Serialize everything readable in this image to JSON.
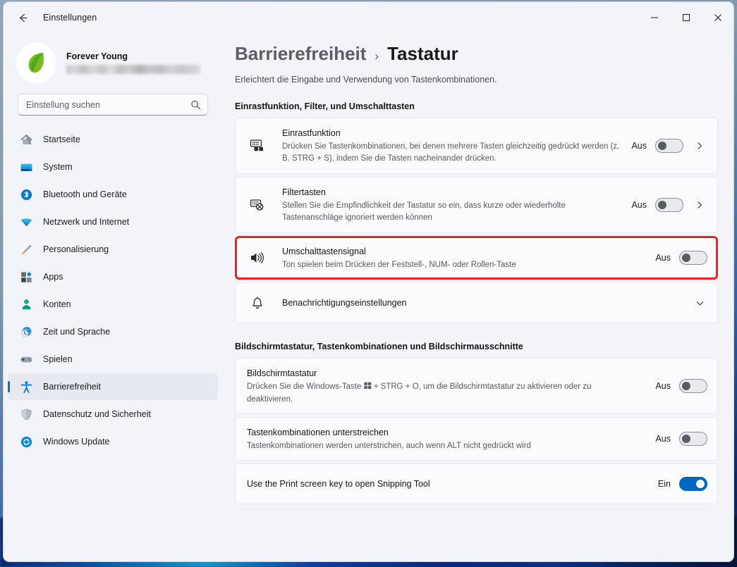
{
  "window": {
    "app_title": "Einstellungen",
    "back_icon": "back-arrow-icon",
    "minimize_label": "—",
    "maximize_label": "□",
    "close_label": "✕"
  },
  "sidebar": {
    "account": {
      "name": "Forever Young",
      "email_redacted": true,
      "avatar_icon": "leaf-avatar-icon"
    },
    "search": {
      "placeholder": "Einstellung suchen",
      "value": "",
      "icon": "search-icon"
    },
    "items": [
      {
        "label": "Startseite",
        "icon": "home-icon",
        "selected": false
      },
      {
        "label": "System",
        "icon": "system-monitor-icon",
        "selected": false
      },
      {
        "label": "Bluetooth und Geräte",
        "icon": "bluetooth-icon",
        "selected": false
      },
      {
        "label": "Netzwerk und Internet",
        "icon": "wifi-icon",
        "selected": false
      },
      {
        "label": "Personalisierung",
        "icon": "paintbrush-icon",
        "selected": false
      },
      {
        "label": "Apps",
        "icon": "apps-icon",
        "selected": false
      },
      {
        "label": "Konten",
        "icon": "account-person-icon",
        "selected": false
      },
      {
        "label": "Zeit und Sprache",
        "icon": "clock-globe-icon",
        "selected": false
      },
      {
        "label": "Spielen",
        "icon": "gamepad-icon",
        "selected": false
      },
      {
        "label": "Barrierefreiheit",
        "icon": "accessibility-person-icon",
        "selected": true
      },
      {
        "label": "Datenschutz und Sicherheit",
        "icon": "shield-icon",
        "selected": false
      },
      {
        "label": "Windows Update",
        "icon": "update-refresh-icon",
        "selected": false
      }
    ]
  },
  "main": {
    "breadcrumb": {
      "parent": "Barrierefreiheit",
      "separator": "›",
      "current": "Tastatur"
    },
    "subtitle": "Erleichtert die Eingabe und Verwendung von Tastenkombinationen.",
    "sections": [
      {
        "title": "Einrastfunktion, Filter, und Umschalttasten",
        "rows": [
          {
            "icon": "sticky-keys-icon",
            "title": "Einrastfunktion",
            "desc": "Drücken Sie Tastenkombinationen, bei denen mehrere Tasten gleichzeitig gedrückt werden (z. B. STRG + S), indem Sie die Tasten nacheinander drücken.",
            "state_label": "Aus",
            "toggle": "off",
            "chevron": "chevron-right-icon",
            "highlighted": false
          },
          {
            "icon": "filter-keys-icon",
            "title": "Filtertasten",
            "desc": "Stellen Sie die Empfindlichkeit der Tastatur so ein, dass kurze oder wiederholte Tastenanschläge ignoriert werden können",
            "state_label": "Aus",
            "toggle": "off",
            "chevron": "chevron-right-icon",
            "highlighted": false
          },
          {
            "icon": "sound-speaker-icon",
            "title": "Umschalttastensignal",
            "desc": "Ton spielen beim Drücken der Feststell-, NUM- oder Rollen-Taste",
            "state_label": "Aus",
            "toggle": "off",
            "chevron": null,
            "highlighted": true
          },
          {
            "icon": "bell-notification-icon",
            "title": "Benachrichtigungseinstellungen",
            "desc": null,
            "state_label": null,
            "toggle": null,
            "chevron": "chevron-down-icon",
            "highlighted": false
          }
        ]
      },
      {
        "title": "Bildschirmtastatur, Tastenkombinationen und Bildschirmausschnitte",
        "rows": [
          {
            "icon": null,
            "title": "Bildschirmtastatur",
            "desc_before": "Drücken Sie die Windows-Taste ",
            "desc_after": " + STRG + O, um die Bildschirmtastatur zu aktivieren oder zu deaktivieren.",
            "desc": "Drücken Sie die Windows-Taste ⊞ + STRG + O, um die Bildschirmtastatur zu aktivieren oder zu deaktivieren.",
            "state_label": "Aus",
            "toggle": "off",
            "chevron": null,
            "highlighted": false
          },
          {
            "icon": null,
            "title": "Tastenkombinationen unterstreichen",
            "desc": "Tastenkombinationen werden unterstrichen, auch wenn ALT nicht gedrückt wird",
            "state_label": "Aus",
            "toggle": "off",
            "chevron": null,
            "highlighted": false
          },
          {
            "icon": null,
            "title": "Use the Print screen key to open Snipping Tool",
            "desc": null,
            "state_label": "Ein",
            "toggle": "on",
            "chevron": null,
            "highlighted": false
          }
        ]
      }
    ]
  },
  "colors": {
    "accent": "#0067c0",
    "selection_bar": "#0c6fc5",
    "highlight_border": "#ef2020",
    "window_bg": "#f2f4f9",
    "card_bg": "#fbfbfd"
  }
}
